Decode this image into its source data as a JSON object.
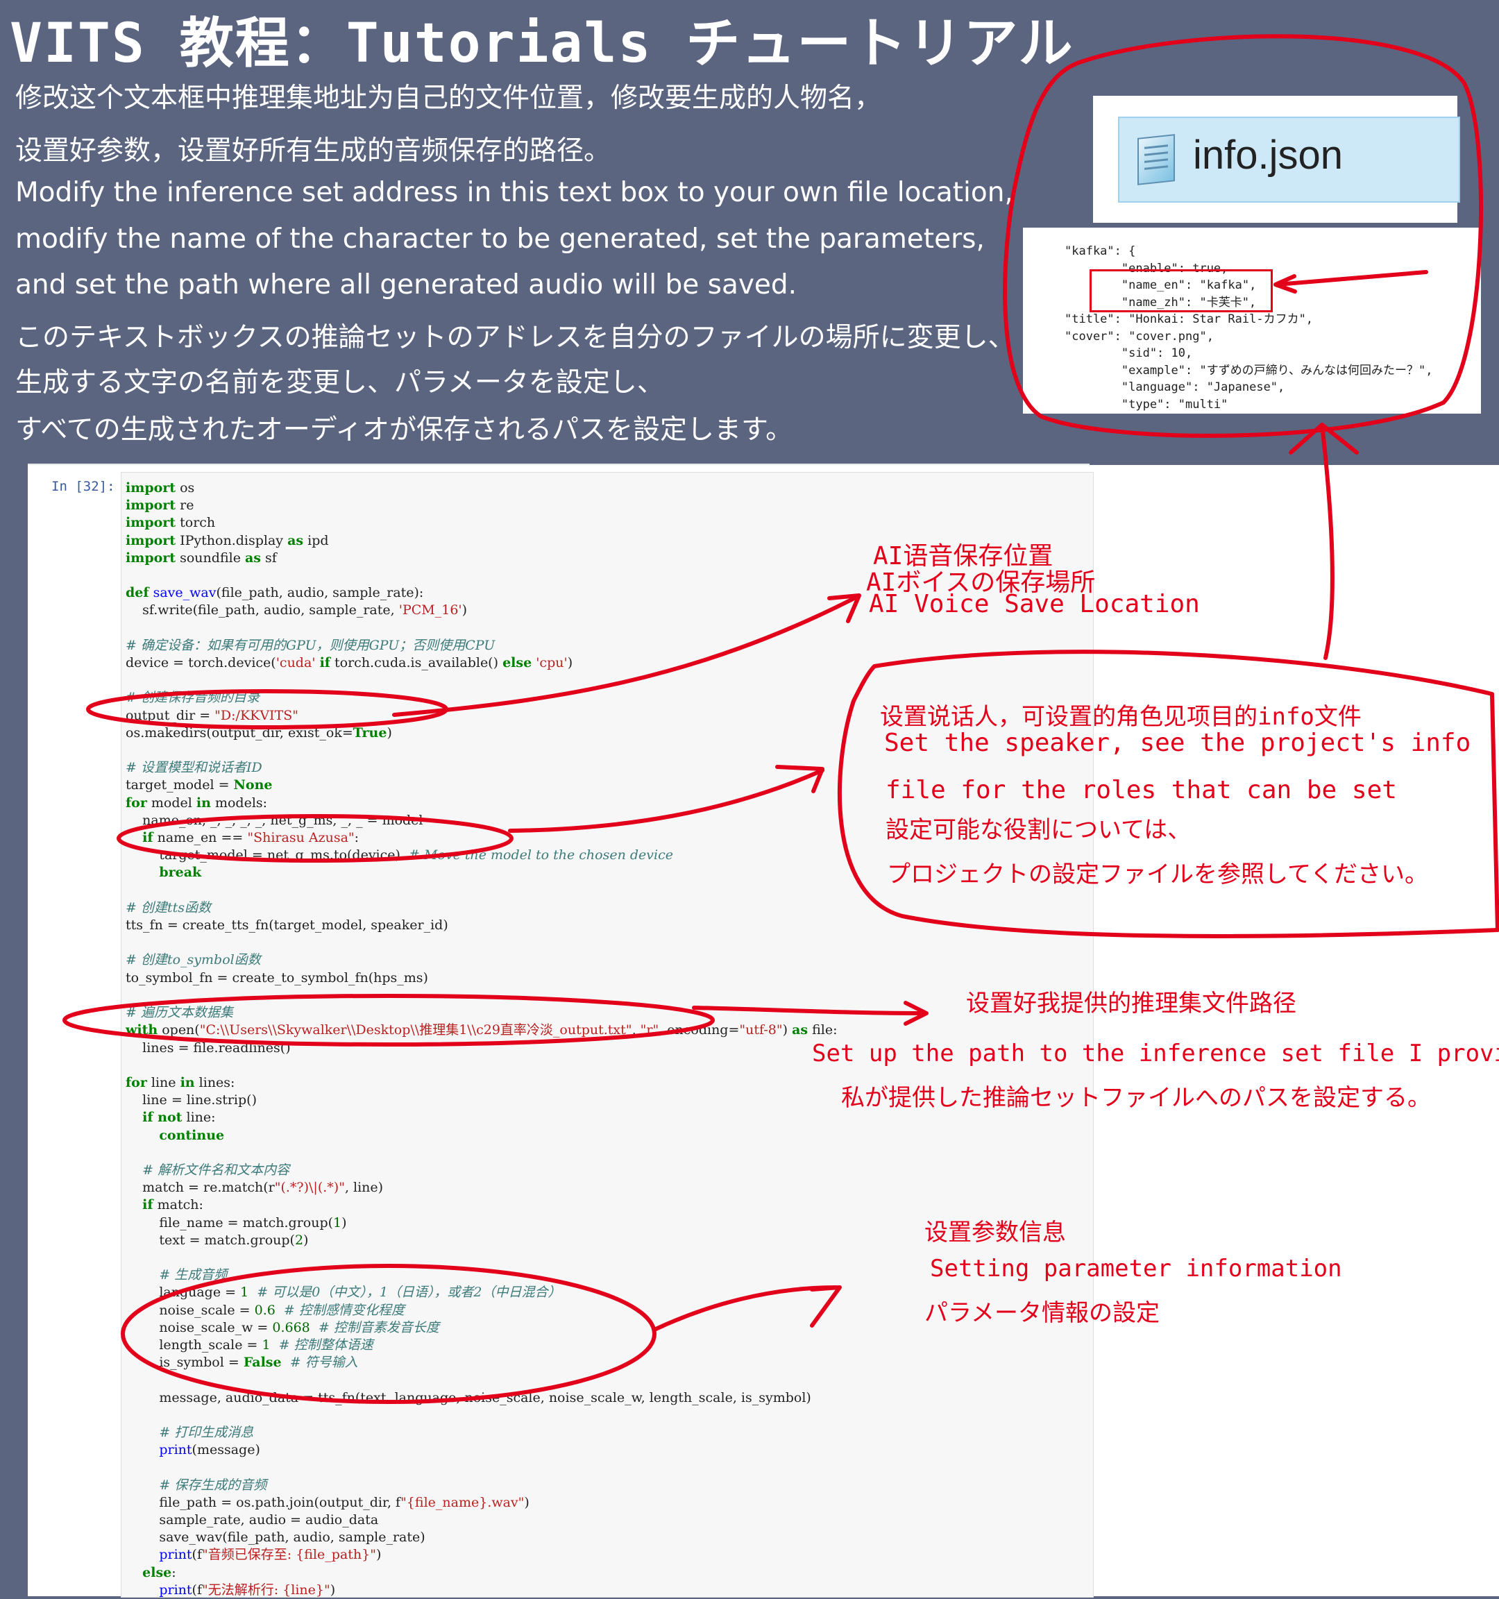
{
  "header": {
    "title": "VITS   教程：Tutorials  チュートリアル"
  },
  "intro": [
    "修改这个文本框中推理集地址为自己的文件位置，修改要生成的人物名，",
    "设置好参数，设置好所有生成的音频保存的路径。",
    "Modify the inference set address in this text box to your own file location,",
    "modify the name of the character to be generated, set the parameters,",
    "and set the path where all generated audio will be saved.",
    "このテキストボックスの推論セットのアドレスを自分のファイルの場所に変更し、",
    "生成する文字の名前を変更し、パラメータを設定し、",
    "すべての生成されたオーディオが保存されるパスを設定します。"
  ],
  "file_card": {
    "file_name": "info.json"
  },
  "json_snippet": [
    "\"kafka\": {",
    "        \"enable\": true,",
    "        \"name_en\": \"kafka\",",
    "        \"name_zh\": \"卡芙卡\",",
    "\"title\": \"Honkai: Star Rail-カフカ\",",
    "\"cover\": \"cover.png\",",
    "        \"sid\": 10,",
    "        \"example\": \"すずめの戸締り、みんなは何回みたー？\",",
    "        \"language\": \"Japanese\",",
    "        \"type\": \"multi\""
  ],
  "notebook": {
    "prompt": "In  [32]:"
  },
  "annotations": {
    "save_location": [
      "AI语音保存位置",
      "AIボイスの保存場所",
      "AI Voice Save Location"
    ],
    "speaker": [
      "设置说话人，可设置的角色见项目的info文件",
      "Set the speaker, see the project's info",
      "file for the roles that can be set",
      "設定可能な役割については、",
      "プロジェクトの設定ファイルを参照してください。"
    ],
    "inference_path": [
      "设置好我提供的推理集文件路径",
      "Set up the path to the inference set file I provided",
      "私が提供した推論セットファイルへのパスを設定する。"
    ],
    "parameters": [
      "设置参数信息",
      "Setting parameter information",
      "パラメータ情報の設定"
    ]
  },
  "colors": {
    "background": "#5b6580",
    "annotation_red": "#e3001b"
  }
}
